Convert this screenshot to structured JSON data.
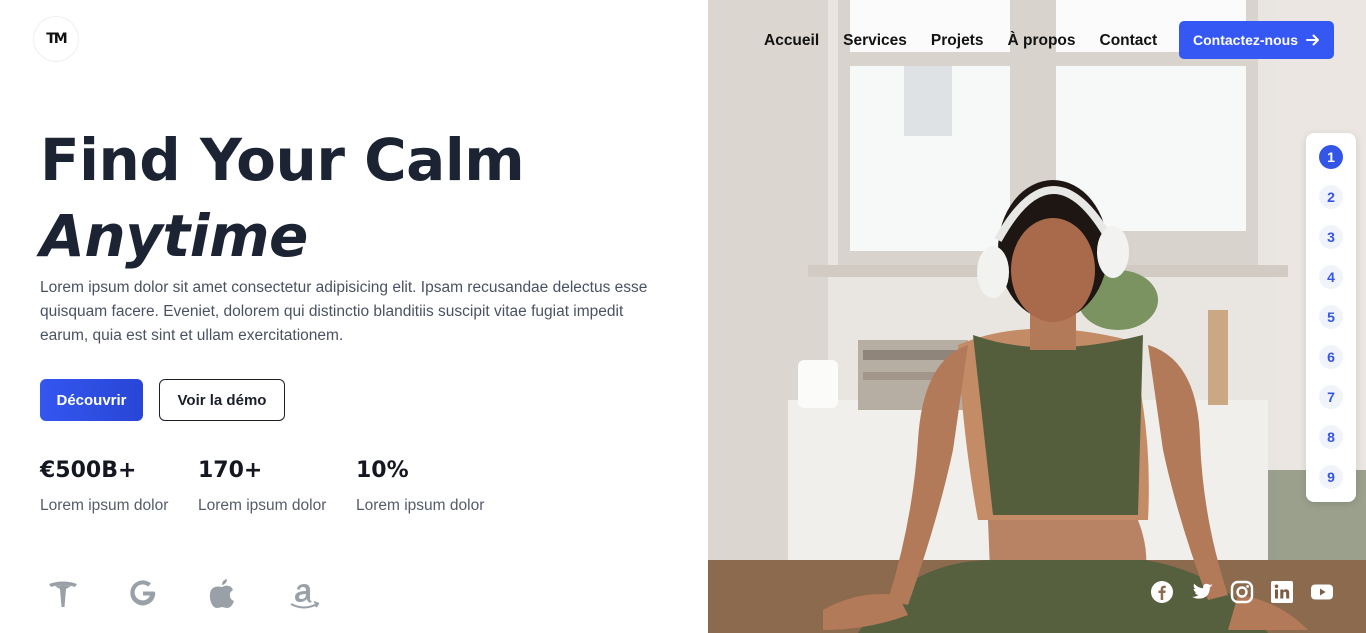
{
  "brand": {
    "logo_text": "TM"
  },
  "nav": {
    "items": [
      "Accueil",
      "Services",
      "Projets",
      "À propos",
      "Contact"
    ],
    "cta_label": "Contactez-nous"
  },
  "hero": {
    "title_line1": "Find Your Calm",
    "title_line2": "Anytime",
    "lead": "Lorem ipsum dolor sit amet consectetur adipisicing elit. Ipsam recusandae delectus esse quisquam facere. Eveniet, dolorem qui distinctio blanditiis suscipit vitae fugiat impedit earum, quia est sint et ullam exercitationem.",
    "primary_button": "Découvrir",
    "secondary_button": "Voir la démo"
  },
  "stats": [
    {
      "value": "€500B+",
      "label": "Lorem ipsum dolor"
    },
    {
      "value": "170+",
      "label": "Lorem ipsum dolor"
    },
    {
      "value": "10%",
      "label": "Lorem ipsum dolor"
    }
  ],
  "brands": [
    "tesla-icon",
    "google-icon",
    "apple-icon",
    "amazon-icon"
  ],
  "pager": {
    "pages": [
      "1",
      "2",
      "3",
      "4",
      "5",
      "6",
      "7",
      "8",
      "9"
    ],
    "active": "1"
  },
  "social": [
    "facebook-icon",
    "twitter-icon",
    "instagram-icon",
    "linkedin-icon",
    "youtube-icon"
  ],
  "colors": {
    "accent": "#3557f3",
    "heading": "#1c2333",
    "body_text": "#4a5262",
    "brand_icon": "#9aa0a8"
  }
}
